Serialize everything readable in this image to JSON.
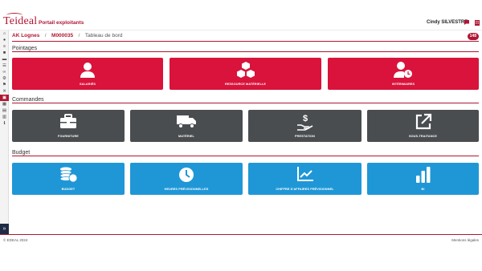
{
  "header": {
    "logo": "Teideal",
    "portal": "Portail exploitants",
    "user": "Cindy SILVESTRE"
  },
  "breadcrumb": {
    "site": "AK Lognes",
    "code": "M000035",
    "current": "Tableau de bord",
    "separator": "/",
    "badge": "148"
  },
  "sections": {
    "pointages": {
      "title": "Pointages",
      "tiles": [
        {
          "label": "SALARIÉS",
          "icon": "user-icon"
        },
        {
          "label": "RESSOURCE MATÉRIELLE",
          "icon": "cubes-icon"
        },
        {
          "label": "INTÉRIMAIRES",
          "icon": "user-clock-icon"
        }
      ]
    },
    "commandes": {
      "title": "Commandes",
      "tiles": [
        {
          "label": "FOURNITURE",
          "icon": "toolbox-icon"
        },
        {
          "label": "MATÉRIEL",
          "icon": "truck-icon"
        },
        {
          "label": "PRESTATION",
          "icon": "hand-dollar-icon"
        },
        {
          "label": "SOUS-TRAITANCE",
          "icon": "external-link-icon"
        }
      ]
    },
    "budget": {
      "title": "Budget",
      "tiles": [
        {
          "label": "BUDGET",
          "icon": "coins-icon"
        },
        {
          "label": "HEURES PRÉVISIONNELLES",
          "icon": "clock-icon"
        },
        {
          "label": "CHIFFRE D'AFFAIRES PRÉVISIONNEL",
          "icon": "line-chart-icon"
        },
        {
          "label": "BI",
          "icon": "bar-chart-icon"
        }
      ]
    }
  },
  "footer": {
    "copyright": "© EDEAL 2024",
    "legal": "Mentions légales"
  },
  "colors": {
    "brand": "#b01632",
    "red_tile": "#d9133b",
    "dark_tile": "#4a4d50",
    "blue_tile": "#1f97d6"
  }
}
